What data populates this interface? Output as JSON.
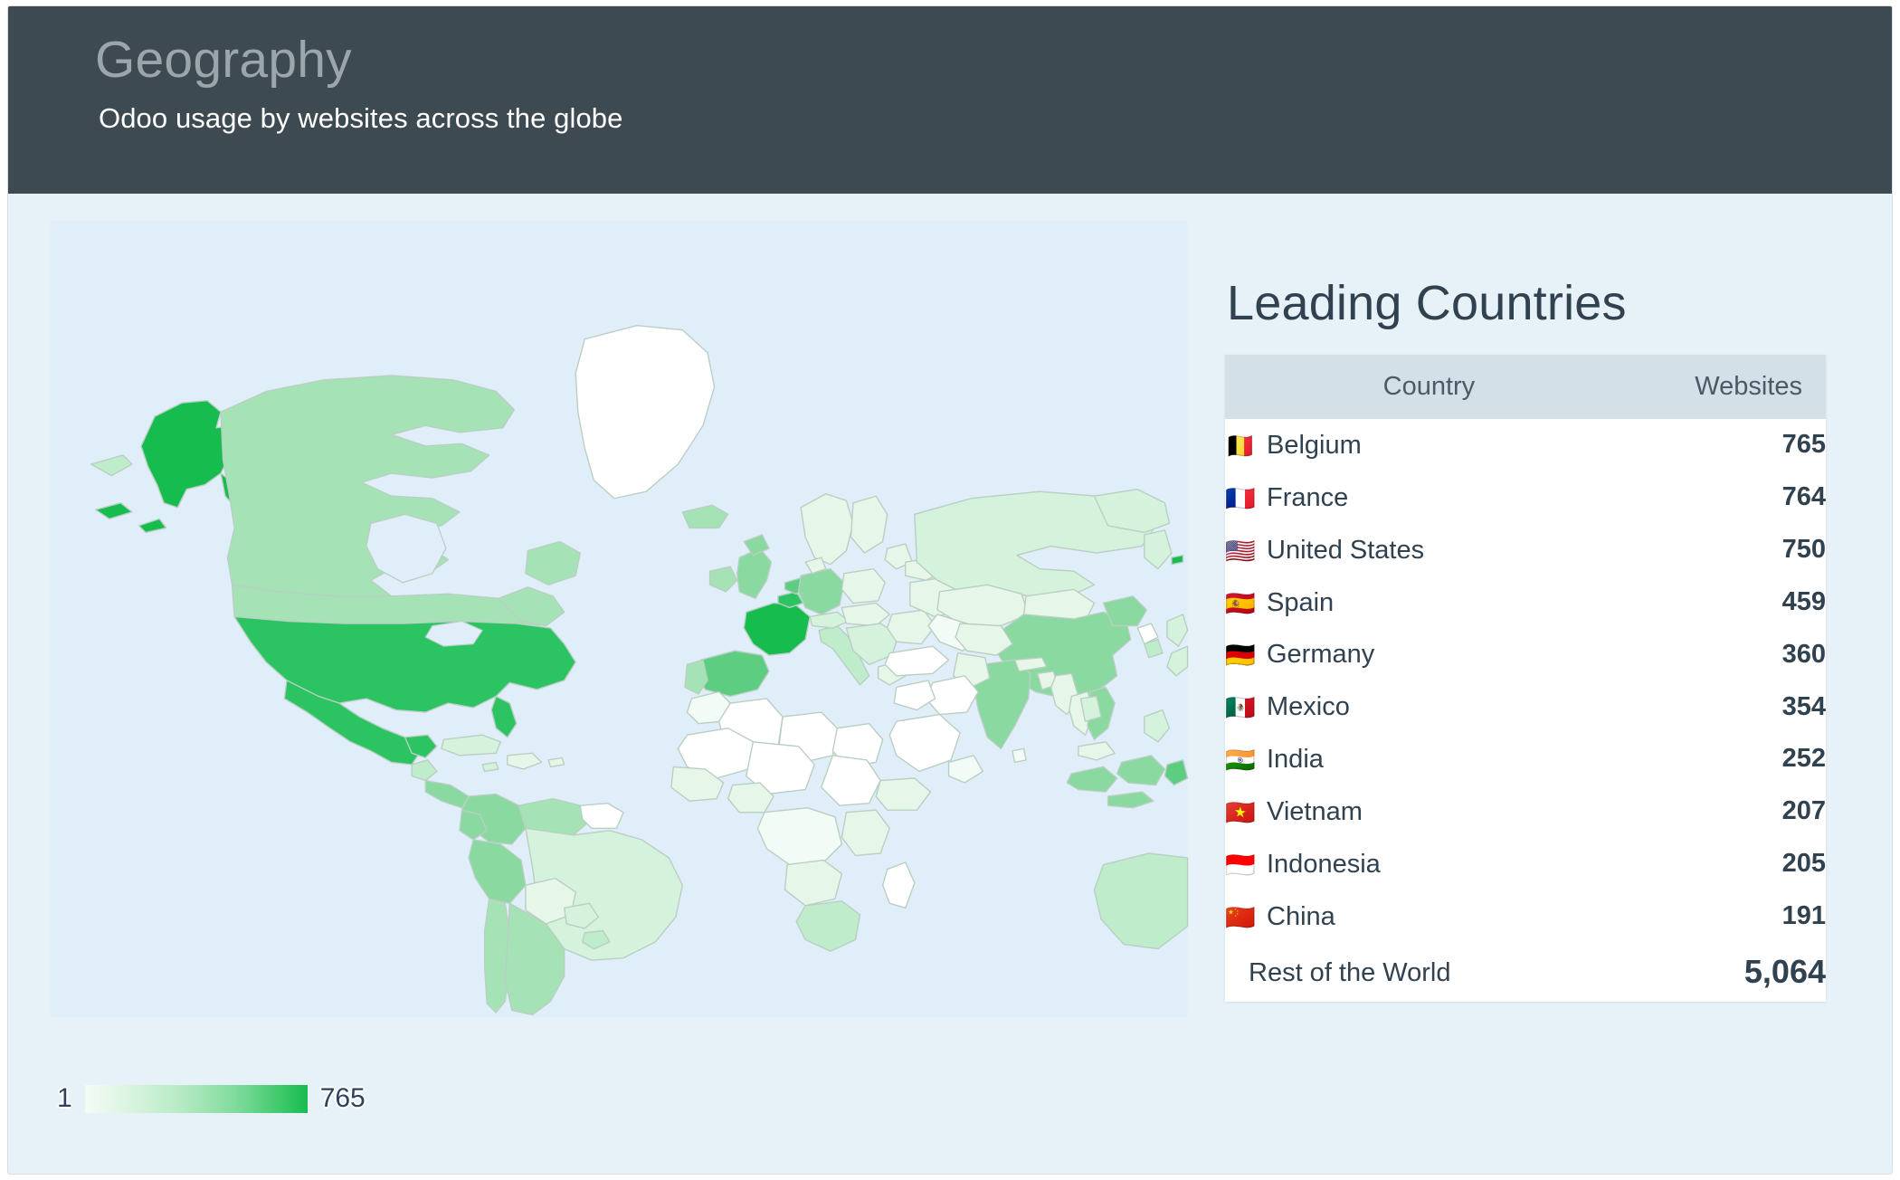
{
  "header": {
    "title": "Geography",
    "subtitle": "Odoo usage by websites across the globe"
  },
  "panel": {
    "title": "Leading Countries",
    "columns": {
      "country": "Country",
      "websites": "Websites"
    },
    "rows": [
      {
        "flag": "🇧🇪",
        "country": "Belgium",
        "websites": "765"
      },
      {
        "flag": "🇫🇷",
        "country": "France",
        "websites": "764"
      },
      {
        "flag": "🇺🇸",
        "country": "United States",
        "websites": "750"
      },
      {
        "flag": "🇪🇸",
        "country": "Spain",
        "websites": "459"
      },
      {
        "flag": "🇩🇪",
        "country": "Germany",
        "websites": "360"
      },
      {
        "flag": "🇲🇽",
        "country": "Mexico",
        "websites": "354"
      },
      {
        "flag": "🇮🇳",
        "country": "India",
        "websites": "252"
      },
      {
        "flag": "🇻🇳",
        "country": "Vietnam",
        "websites": "207"
      },
      {
        "flag": "🇮🇩",
        "country": "Indonesia",
        "websites": "205"
      },
      {
        "flag": "🇨🇳",
        "country": "China",
        "websites": "191"
      },
      {
        "flag": "",
        "country": "Rest of the World",
        "websites": "5,064"
      }
    ]
  },
  "legend": {
    "min_label": "1",
    "max_label": "765"
  },
  "colors": {
    "header_bg": "#3e4a52",
    "header_title": "#9aa5ac",
    "body_bg": "#e7f1f8",
    "ocean": "#dfeef8",
    "table_head_bg": "#d3e0e7",
    "text_navy": "#2c4260",
    "scale_min": "#f3fcf5",
    "scale_max": "#17bc4f",
    "no_data": "#ffffff"
  },
  "chart_data": {
    "type": "choropleth",
    "title": "Geography",
    "subtitle": "Odoo usage by websites across the globe",
    "value_label": "Websites",
    "scale_min": 1,
    "scale_max": 765,
    "legend_position": "bottom-left",
    "categories": [
      "Belgium",
      "France",
      "United States",
      "Spain",
      "Germany",
      "Mexico",
      "India",
      "Vietnam",
      "Indonesia",
      "China",
      "Rest of the World"
    ],
    "values": [
      765,
      764,
      750,
      459,
      360,
      354,
      252,
      207,
      205,
      191,
      5064
    ],
    "country_shading": {
      "France": 764,
      "Belgium": 765,
      "United States": 750,
      "Spain": 459,
      "Germany": 360,
      "Mexico": 354,
      "India": 252,
      "Vietnam": 207,
      "Indonesia": 205,
      "China": 191,
      "Canada": 120,
      "Brazil": 90,
      "Russia": 70,
      "Australia": 80,
      "Argentina": 60,
      "Colombia": 60,
      "Netherlands": 150,
      "Italy": 90,
      "United Kingdom": 110,
      "Greenland": 0,
      "Sahara region": 0
    }
  }
}
